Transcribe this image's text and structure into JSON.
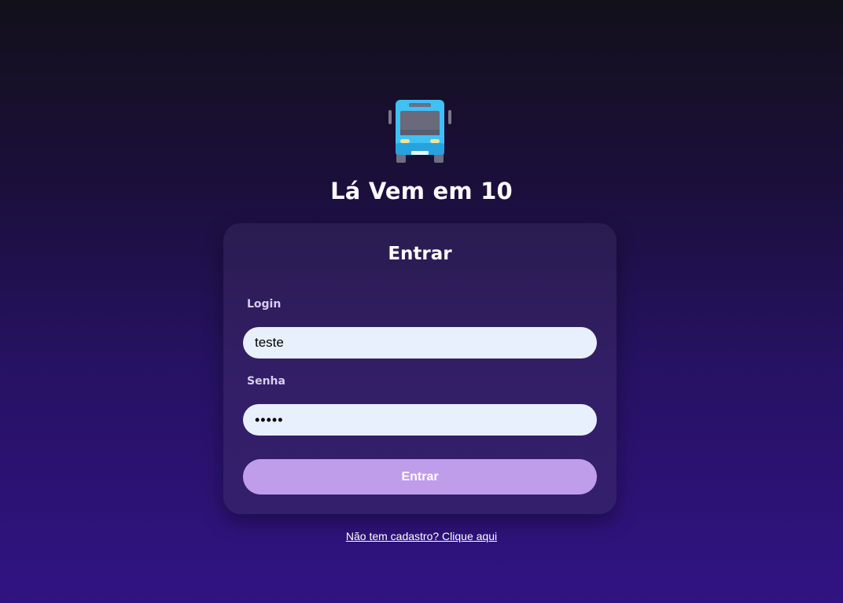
{
  "app": {
    "title": "Lá Vem em 10",
    "logo_icon": "bus-icon"
  },
  "login_card": {
    "title": "Entrar",
    "login_label": "Login",
    "login_value": "teste",
    "password_label": "Senha",
    "password_value": "•••••",
    "submit_label": "Entrar"
  },
  "signup_link": "Não tem cadastro? Clique aqui",
  "colors": {
    "background_top": "#12101a",
    "background_bottom": "#311383",
    "card": "#2f1d60",
    "input_bg": "#e8f0fe",
    "button_bg": "#bf9deb"
  }
}
